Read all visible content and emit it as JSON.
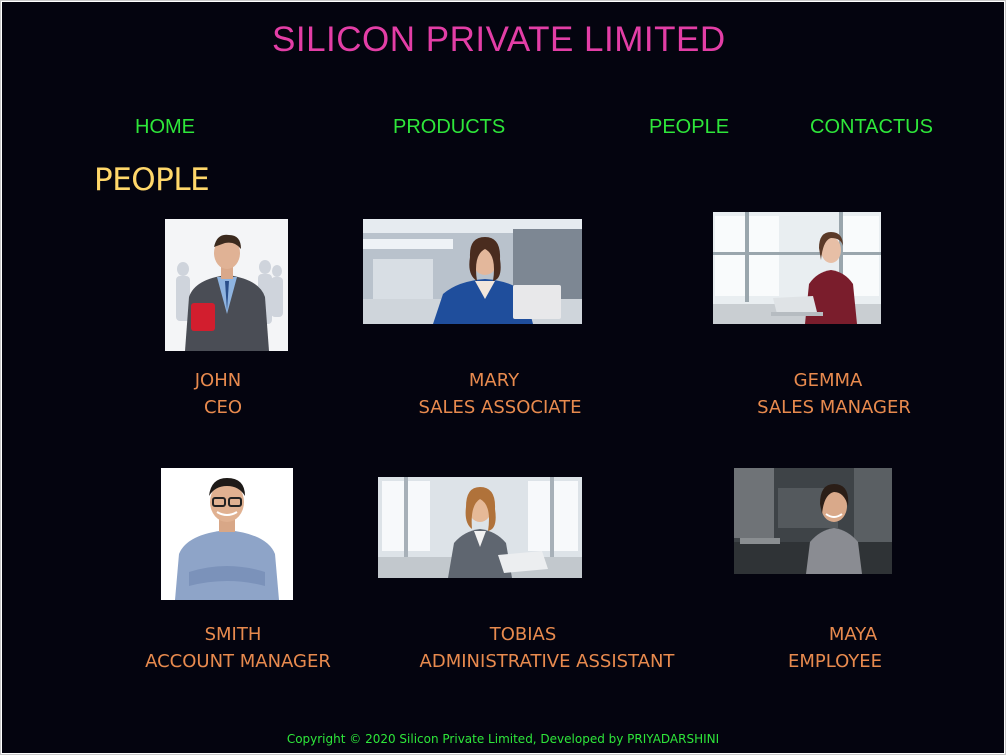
{
  "header": {
    "title": "SILICON PRIVATE LIMITED"
  },
  "nav": {
    "items": [
      {
        "label": "HOME"
      },
      {
        "label": "PRODUCTS"
      },
      {
        "label": "PEOPLE"
      },
      {
        "label": "CONTACTUS"
      }
    ]
  },
  "page": {
    "heading": "PEOPLE"
  },
  "people": [
    {
      "name": "JOHN",
      "role": "CEO"
    },
    {
      "name": "MARY",
      "role": "SALES ASSOCIATE"
    },
    {
      "name": "GEMMA",
      "role": "SALES MANAGER"
    },
    {
      "name": "SMITH",
      "role": "ACCOUNT MANAGER"
    },
    {
      "name": "TOBIAS",
      "role": "ADMINISTRATIVE ASSISTANT"
    },
    {
      "name": "MAYA",
      "role": "EMPLOYEE"
    }
  ],
  "footer": {
    "text": "Copyright © 2020 Silicon Private Limited, Developed by PRIYADARSHINI"
  },
  "colors": {
    "background": "#04040f",
    "title": "#e33ea6",
    "nav": "#2ee63a",
    "heading": "#ffd76a",
    "caption": "#e88a4e"
  }
}
